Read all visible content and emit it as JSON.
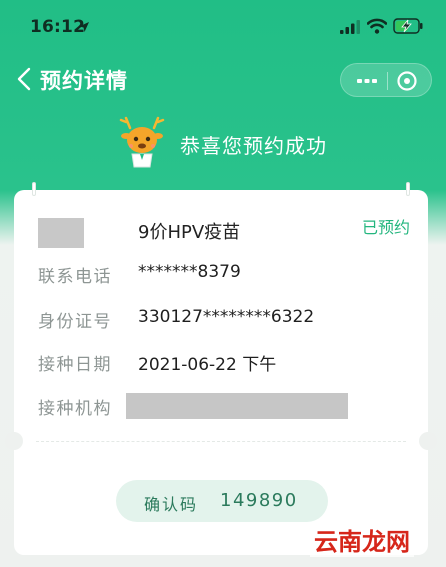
{
  "status_bar": {
    "time": "16:12",
    "icons": [
      "location-arrow-icon",
      "signal-icon",
      "wifi-icon",
      "battery-charging-icon"
    ]
  },
  "nav": {
    "title": "预约详情",
    "back_icon": "chevron-left-icon",
    "more_icon": "more-dots-icon",
    "close_icon": "close-circle-icon"
  },
  "banner": {
    "mascot_icon": "deer-mascot-icon",
    "message": "恭喜您预约成功"
  },
  "appointment": {
    "vaccine_name": "9价HPV疫苗",
    "status": "已预约",
    "phone_label": "联系电话",
    "phone_value": "*******8379",
    "id_label": "身份证号",
    "id_value": "330127********6322",
    "date_label": "接种日期",
    "date_value": "2021-06-22 下午",
    "institution_label": "接种机构"
  },
  "confirmation": {
    "label": "确认码",
    "code": "149890"
  },
  "watermark": {
    "text": "云南龙网"
  },
  "colors": {
    "brand_green": "#21be86",
    "status_green": "#24b67f",
    "code_bg": "#e3f3ec",
    "code_text": "#2b7a5c",
    "watermark_red": "#d6261a"
  }
}
